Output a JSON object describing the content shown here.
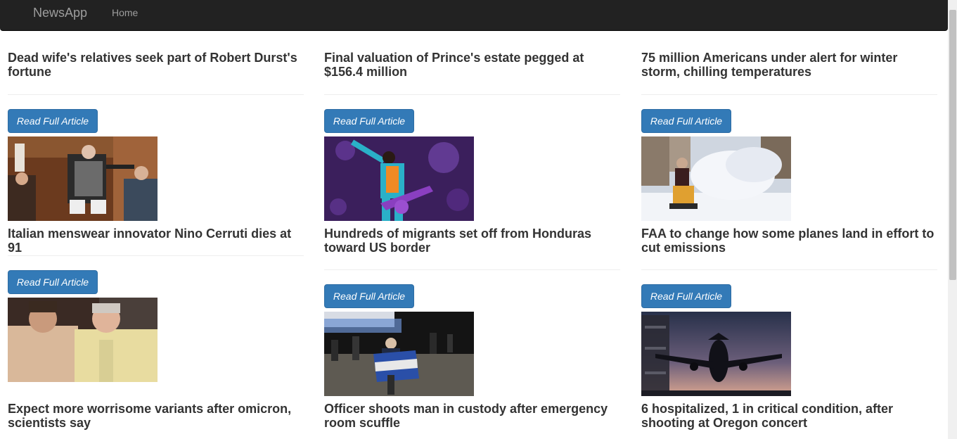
{
  "navbar": {
    "brand": "NewsApp",
    "home": "Home"
  },
  "columns": [
    {
      "articles": [
        {
          "title": "Dead wife's relatives seek part of Robert Durst's fortune",
          "button": "Read Full Article",
          "image": "courtroom-photo"
        },
        {
          "title": "Italian menswear innovator Nino Cerruti dies at 91",
          "button": "Read Full Article",
          "image": "two-men-photo"
        },
        {
          "title": "Expect more worrisome variants after omicron, scientists say"
        }
      ]
    },
    {
      "articles": [
        {
          "title": "Final valuation of Prince's estate pegged at $156.4 million",
          "button": "Read Full Article",
          "image": "concert-guitarist-photo"
        },
        {
          "title": "Hundreds of migrants set off from Honduras toward US border",
          "button": "Read Full Article",
          "image": "migrants-night-photo"
        },
        {
          "title": "Officer shoots man in custody after emergency room scuffle"
        }
      ]
    },
    {
      "articles": [
        {
          "title": "75 million Americans under alert for winter storm, chilling temperatures",
          "button": "Read Full Article",
          "image": "snowblower-photo"
        },
        {
          "title": "FAA to change how some planes land in effort to cut emissions",
          "button": "Read Full Article",
          "image": "airplane-landing-photo"
        },
        {
          "title": "6 hospitalized, 1 in critical condition, after shooting at Oregon concert"
        }
      ]
    }
  ],
  "colors": {
    "navbar": "#222222",
    "button": "#337ab7",
    "text": "#333333"
  }
}
